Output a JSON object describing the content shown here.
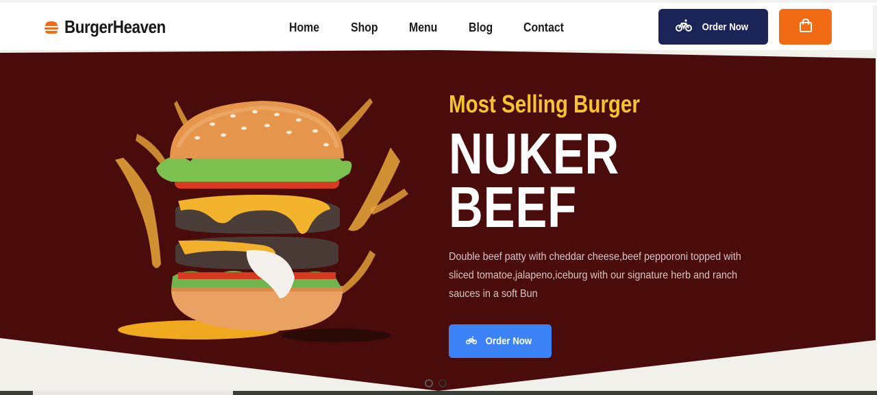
{
  "brand": {
    "name": "BurgerHeaven",
    "icon": "burger-icon",
    "icon_color": "#f06b14"
  },
  "nav": {
    "items": [
      {
        "label": "Home"
      },
      {
        "label": "Shop"
      },
      {
        "label": "Menu"
      },
      {
        "label": "Blog"
      },
      {
        "label": "Contact"
      }
    ]
  },
  "header": {
    "order_button": {
      "label": "Order Now",
      "icon": "bicycle-icon",
      "color": "#1a2456"
    },
    "cart_button": {
      "icon": "shopping-bag-icon",
      "color": "#f06b14"
    }
  },
  "hero": {
    "subtitle": "Most Selling Burger",
    "title_line1": "NUKER",
    "title_line2": "BEEF",
    "description": "Double beef patty with cheddar cheese,beef pepporoni topped with sliced tomatoe,jalapeno,iceburg with our signature herb and ranch sauces in a soft Bun",
    "order_button": {
      "label": "Order Now",
      "icon": "bicycle-icon",
      "color": "#3b82f6"
    },
    "background_color": "#4a0b0b",
    "subtitle_color": "#f7c32e",
    "image": "burger-image"
  },
  "carousel": {
    "slides": 2,
    "active_index": 1
  }
}
